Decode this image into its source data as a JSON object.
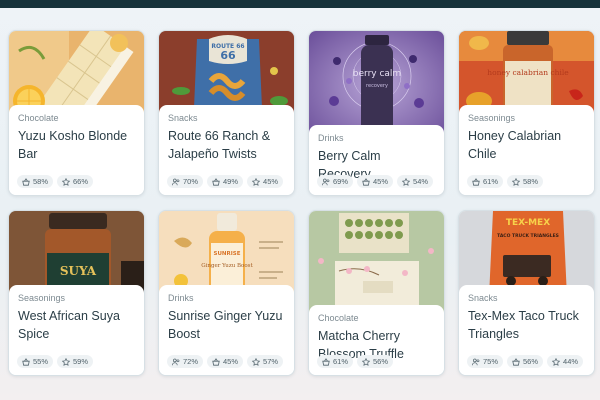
{
  "products": [
    {
      "category": "Chocolate",
      "title": "Yuzu Kosho Blonde Bar",
      "stats": [
        {
          "icon": "basket-icon",
          "value": "58%"
        },
        {
          "icon": "star-icon",
          "value": "66%"
        }
      ]
    },
    {
      "category": "Snacks",
      "title": "Route 66 Ranch & Jalapeño Twists",
      "stats": [
        {
          "icon": "users-icon",
          "value": "70%"
        },
        {
          "icon": "basket-icon",
          "value": "49%"
        },
        {
          "icon": "star-icon",
          "value": "45%"
        }
      ],
      "pack_sign": "ROUTE 66",
      "pack_sub": "RANCH & JALAPEÑO"
    },
    {
      "category": "Drinks",
      "title": "Berry Calm Recovery",
      "stats": [
        {
          "icon": "users-icon",
          "value": "69%"
        },
        {
          "icon": "basket-icon",
          "value": "45%"
        },
        {
          "icon": "star-icon",
          "value": "54%"
        }
      ],
      "bottle_text": "berry calm",
      "bottle_sub": "recovery"
    },
    {
      "category": "Seasonings",
      "title": "Honey Calabrian Chile",
      "stats": [
        {
          "icon": "basket-icon",
          "value": "61%"
        },
        {
          "icon": "star-icon",
          "value": "58%"
        }
      ],
      "jar_text": "honey calabrian chile"
    },
    {
      "category": "Seasonings",
      "title": "West African Suya Spice",
      "stats": [
        {
          "icon": "basket-icon",
          "value": "55%"
        },
        {
          "icon": "star-icon",
          "value": "59%"
        }
      ],
      "jar_text": "SUYA"
    },
    {
      "category": "Drinks",
      "title": "Sunrise Ginger Yuzu Boost",
      "stats": [
        {
          "icon": "users-icon",
          "value": "72%"
        },
        {
          "icon": "basket-icon",
          "value": "45%"
        },
        {
          "icon": "star-icon",
          "value": "57%"
        }
      ],
      "bottle_sub": "SUNRISE",
      "bottle_text": "Ginger Yuzu Boost"
    },
    {
      "category": "Chocolate",
      "title": "Matcha Cherry Blossom Truffle",
      "stats": [
        {
          "icon": "basket-icon",
          "value": "61%"
        },
        {
          "icon": "star-icon",
          "value": "56%"
        }
      ]
    },
    {
      "category": "Snacks",
      "title": "Tex-Mex Taco Truck Triangles",
      "stats": [
        {
          "icon": "users-icon",
          "value": "75%"
        },
        {
          "icon": "basket-icon",
          "value": "56%"
        },
        {
          "icon": "star-icon",
          "value": "44%"
        }
      ],
      "pack_sign": "TEX-MEX",
      "pack_sub": "TACO TRUCK TRIANGLES"
    }
  ]
}
